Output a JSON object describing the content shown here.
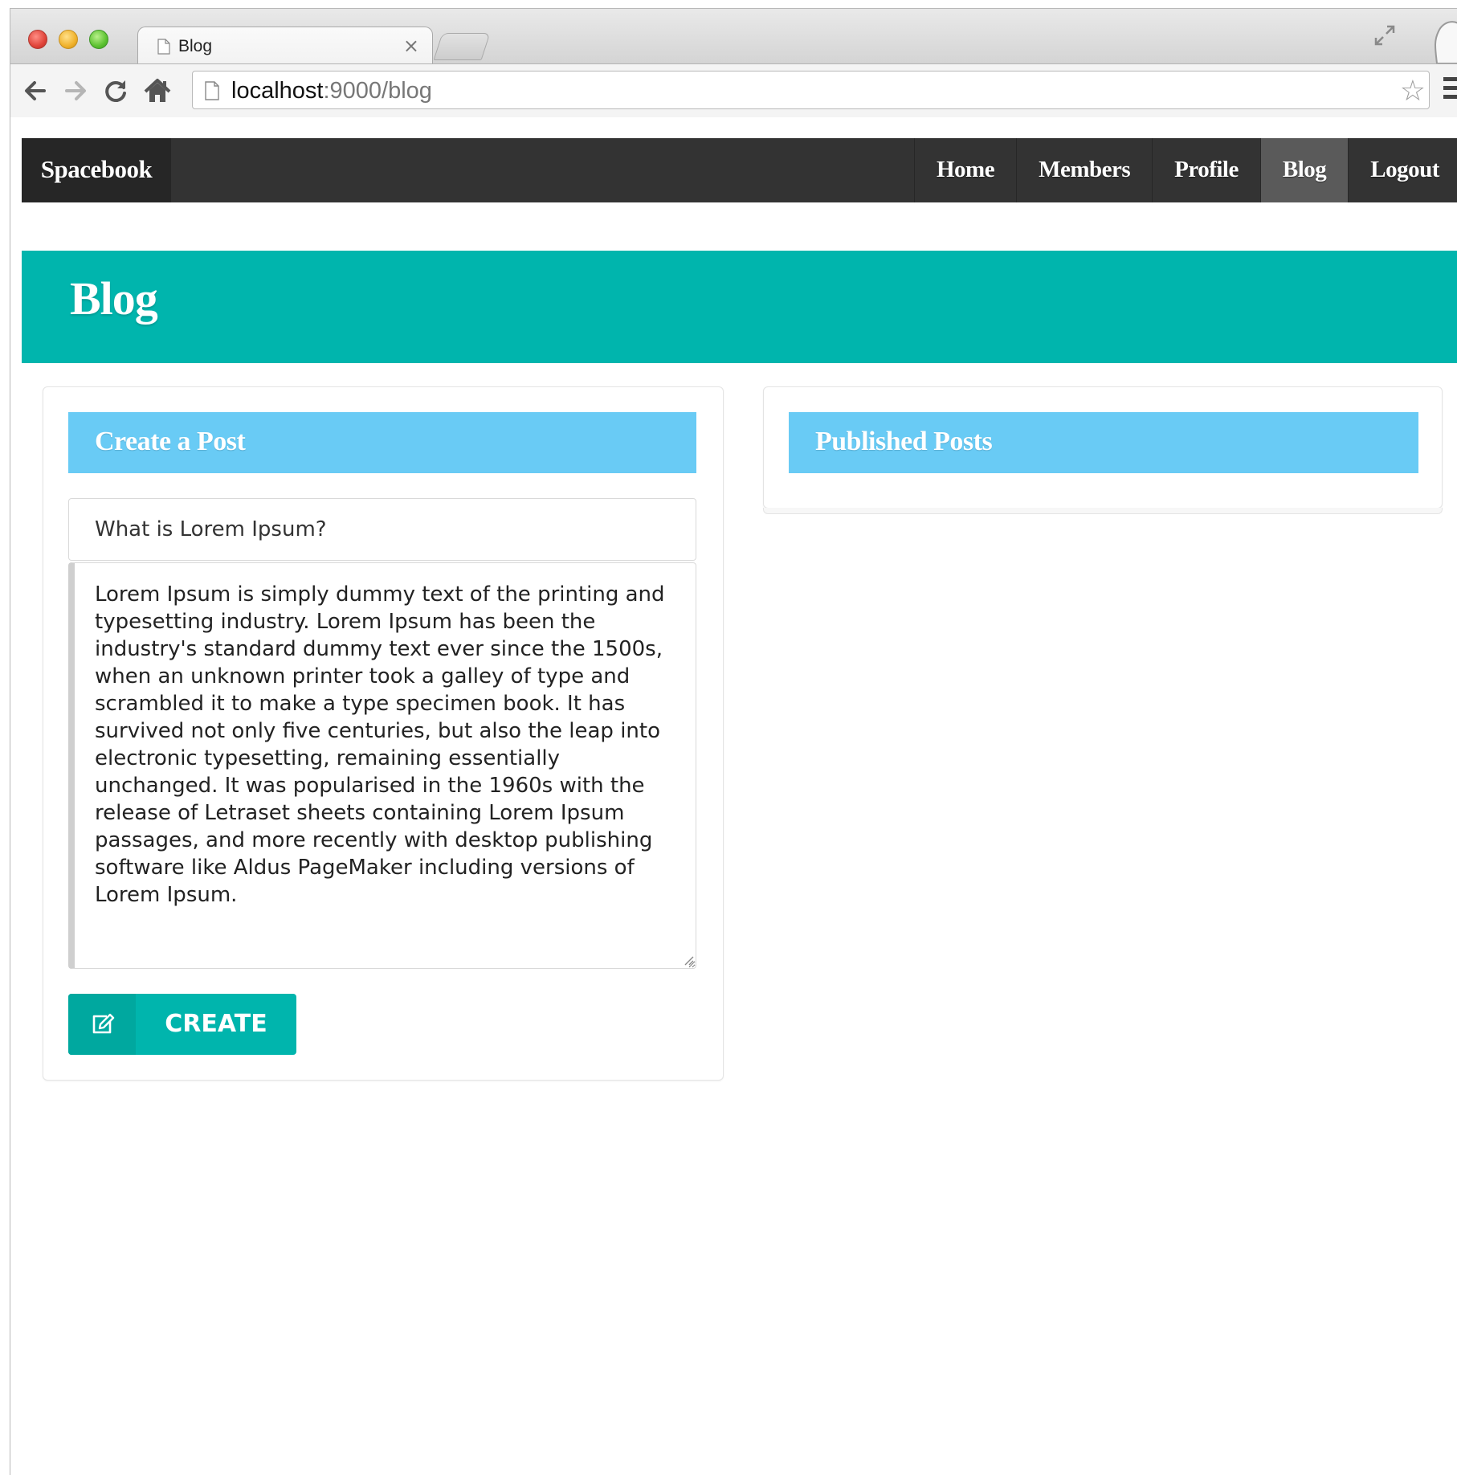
{
  "browser": {
    "tab_title": "Blog",
    "url_host": "localhost",
    "url_rest": ":9000/blog"
  },
  "navbar": {
    "brand": "Spacebook",
    "links": [
      {
        "label": "Home"
      },
      {
        "label": "Members"
      },
      {
        "label": "Profile"
      },
      {
        "label": "Blog",
        "active": true
      },
      {
        "label": "Logout"
      }
    ]
  },
  "header": {
    "title": "Blog"
  },
  "create_post": {
    "heading": "Create a Post",
    "title_value": "What is Lorem Ipsum?",
    "body_value": "Lorem Ipsum is simply dummy text of the printing and typesetting industry. Lorem Ipsum has been the industry's standard dummy text ever since the 1500s, when an unknown printer took a galley of type and scrambled it to make a type specimen book. It has survived not only five centuries, but also the leap into electronic typesetting, remaining essentially unchanged. It was popularised in the 1960s with the release of Letraset sheets containing Lorem Ipsum passages, and more recently with desktop publishing software like Aldus PageMaker including versions of Lorem Ipsum.",
    "button_label": "CREATE",
    "button_icon": "edit-icon"
  },
  "published_posts": {
    "heading": "Published Posts"
  },
  "colors": {
    "header_teal": "#00b5ad",
    "segment_header_blue": "#69cbf5",
    "navbar_dark": "#333333",
    "navbar_active": "#5a5a5a"
  }
}
